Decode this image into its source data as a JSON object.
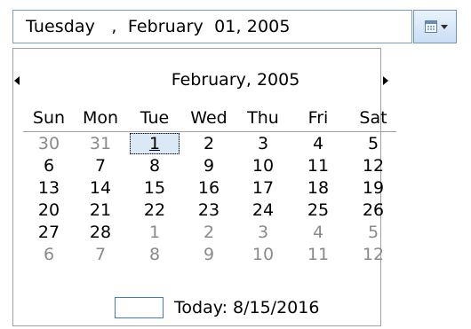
{
  "date_field": {
    "value": "Tuesday   ,  February  01, 2005"
  },
  "calendar": {
    "month_title": "February, 2005",
    "weekdays": [
      "Sun",
      "Mon",
      "Tue",
      "Wed",
      "Thu",
      "Fri",
      "Sat"
    ],
    "weeks": [
      [
        {
          "d": "30",
          "other": true
        },
        {
          "d": "31",
          "other": true
        },
        {
          "d": "1",
          "selected": true
        },
        {
          "d": "2"
        },
        {
          "d": "3"
        },
        {
          "d": "4"
        },
        {
          "d": "5"
        }
      ],
      [
        {
          "d": "6"
        },
        {
          "d": "7"
        },
        {
          "d": "8"
        },
        {
          "d": "9"
        },
        {
          "d": "10"
        },
        {
          "d": "11"
        },
        {
          "d": "12"
        }
      ],
      [
        {
          "d": "13"
        },
        {
          "d": "14"
        },
        {
          "d": "15"
        },
        {
          "d": "16"
        },
        {
          "d": "17"
        },
        {
          "d": "18"
        },
        {
          "d": "19"
        }
      ],
      [
        {
          "d": "20"
        },
        {
          "d": "21"
        },
        {
          "d": "22"
        },
        {
          "d": "23"
        },
        {
          "d": "24"
        },
        {
          "d": "25"
        },
        {
          "d": "26"
        }
      ],
      [
        {
          "d": "27"
        },
        {
          "d": "28"
        },
        {
          "d": "1",
          "other": true
        },
        {
          "d": "2",
          "other": true
        },
        {
          "d": "3",
          "other": true
        },
        {
          "d": "4",
          "other": true
        },
        {
          "d": "5",
          "other": true
        }
      ],
      [
        {
          "d": "6",
          "other": true
        },
        {
          "d": "7",
          "other": true
        },
        {
          "d": "8",
          "other": true
        },
        {
          "d": "9",
          "other": true
        },
        {
          "d": "10",
          "other": true
        },
        {
          "d": "11",
          "other": true
        },
        {
          "d": "12",
          "other": true
        }
      ]
    ],
    "today_label": "Today: 8/15/2016",
    "selected_date": "1"
  },
  "icons": {
    "dropdown": "calendar-icon",
    "chevron": "chevron-down-icon",
    "prev": "arrow-left-icon",
    "next": "arrow-right-icon"
  },
  "colors": {
    "field_border": "#7a9cc6",
    "panel_border": "#a0a0a0",
    "other_month_text": "#8a8a8a",
    "today_box_border": "#3d7ac8",
    "selected_fill": "#dbe8f6"
  }
}
